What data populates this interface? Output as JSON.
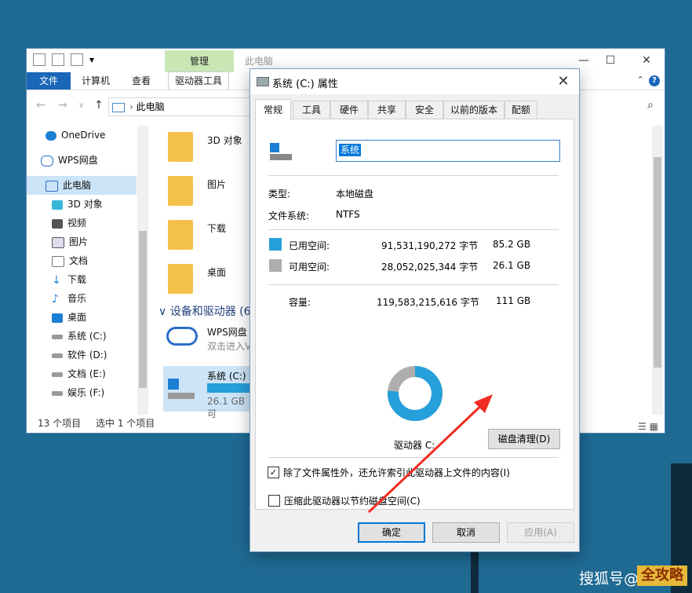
{
  "explorer": {
    "ribbon_context": "管理",
    "title": "此电脑",
    "tabs": [
      "文件",
      "计算机",
      "查看",
      "驱动器工具"
    ],
    "address": "此电脑",
    "sidebar": [
      {
        "label": "OneDrive",
        "icon": "cloud-icon"
      },
      {
        "label": "WPS网盘",
        "icon": "wps-cloud-icon"
      },
      {
        "label": "此电脑",
        "icon": "computer-icon"
      },
      {
        "label": "3D 对象",
        "icon": "cube-icon"
      },
      {
        "label": "视频",
        "icon": "video-icon"
      },
      {
        "label": "图片",
        "icon": "picture-icon"
      },
      {
        "label": "文档",
        "icon": "document-icon"
      },
      {
        "label": "下载",
        "icon": "download-icon"
      },
      {
        "label": "音乐",
        "icon": "music-icon"
      },
      {
        "label": "桌面",
        "icon": "desktop-icon"
      },
      {
        "label": "系统 (C:)",
        "icon": "drive-icon"
      },
      {
        "label": "软件 (D:)",
        "icon": "drive-icon"
      },
      {
        "label": "文档 (E:)",
        "icon": "drive-icon"
      },
      {
        "label": "娱乐 (F:)",
        "icon": "drive-icon"
      }
    ],
    "folders": [
      "3D 对象",
      "图片",
      "下载",
      "桌面"
    ],
    "group_header": "设备和驱动器 (6",
    "wps_drive": {
      "name": "WPS网盘",
      "sub": "双击进入V"
    },
    "c_drive": {
      "name": "系统 (C:)",
      "free": "26.1 GB 可"
    },
    "status_count": "13 个项目",
    "status_selected": "选中 1 个项目"
  },
  "dialog": {
    "title": "系统 (C:) 属性",
    "tabs": [
      "常规",
      "工具",
      "硬件",
      "共享",
      "安全",
      "以前的版本",
      "配额"
    ],
    "name_value": "系统",
    "type_label": "类型:",
    "type_value": "本地磁盘",
    "fs_label": "文件系统:",
    "fs_value": "NTFS",
    "used_label": "已用空间:",
    "used_bytes": "91,531,190,272 字节",
    "used_gb": "85.2 GB",
    "free_label": "可用空间:",
    "free_bytes": "28,052,025,344 字节",
    "free_gb": "26.1 GB",
    "cap_label": "容量:",
    "cap_bytes": "119,583,215,616 字节",
    "cap_gb": "111 GB",
    "used_fraction": 0.7654,
    "drive_label": "驱动器 C:",
    "cleanup_button": "磁盘清理(D)",
    "compress_label": "压缩此驱动器以节约磁盘空间(C)",
    "index_label": "除了文件属性外，还允许索引此驱动器上文件的内容(I)",
    "ok_button": "确定",
    "cancel_button": "取消",
    "apply_button": "应用(A)",
    "used_color": "#26a0da",
    "free_color": "#aeaeae"
  },
  "watermark": {
    "text": "搜狐号@",
    "logo": "全攻略"
  }
}
